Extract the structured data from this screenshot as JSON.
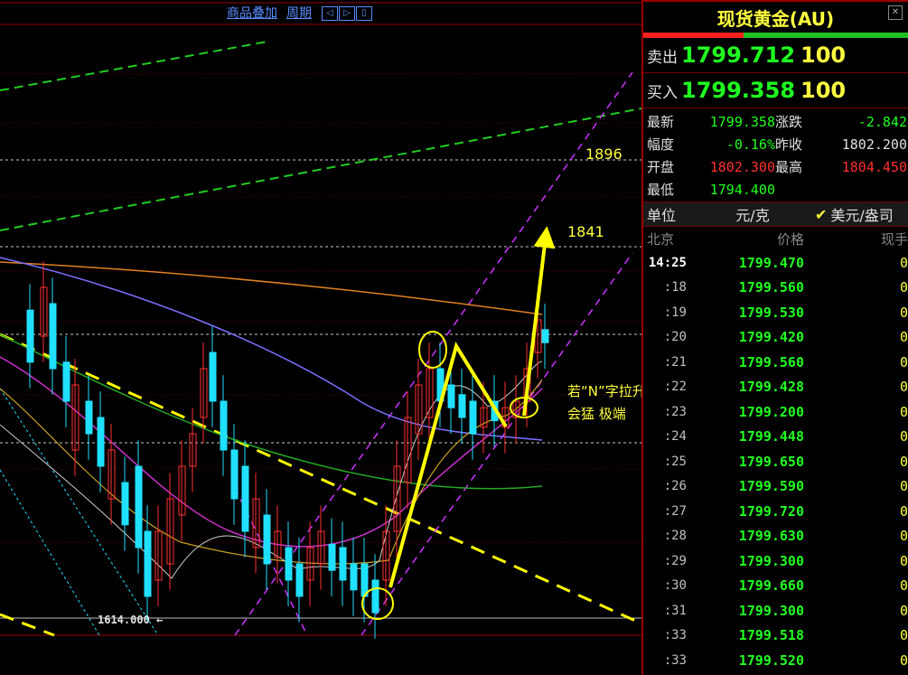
{
  "toolbar": {
    "overlay_label": "商品叠加",
    "period_label": "周期"
  },
  "chart_data": {
    "type": "candlestick",
    "price_labels": [
      {
        "text": "1896",
        "value": 1896
      },
      {
        "text": "1841",
        "value": 1841
      }
    ],
    "low_marker": "1614.000",
    "annotation_line1": "若“N”字拉升",
    "annotation_line2": "会猛 极端",
    "colors": {
      "up": "#ff3030",
      "down": "#20e0ff",
      "target_arrow": "#ffff00",
      "channel": "#cc33ff",
      "trend_green": "#22cc22",
      "resistance": "#ffff00"
    },
    "candles": [
      [
        30,
        28,
        12,
        38,
        -1
      ],
      [
        45,
        20,
        5,
        35,
        1
      ],
      [
        55,
        30,
        10,
        50,
        -1
      ],
      [
        70,
        40,
        28,
        55,
        -1
      ],
      [
        80,
        55,
        35,
        70,
        1
      ],
      [
        95,
        50,
        40,
        65,
        -1
      ],
      [
        108,
        60,
        45,
        80,
        -1
      ],
      [
        120,
        70,
        55,
        85,
        1
      ],
      [
        135,
        78,
        65,
        95,
        -1
      ],
      [
        150,
        85,
        60,
        100,
        -1
      ],
      [
        160,
        100,
        80,
        110,
        -1
      ],
      [
        172,
        95,
        80,
        115,
        1
      ],
      [
        185,
        90,
        70,
        105,
        1
      ],
      [
        198,
        75,
        60,
        95,
        1
      ],
      [
        210,
        60,
        50,
        75,
        1
      ],
      [
        222,
        45,
        30,
        55,
        1
      ],
      [
        232,
        40,
        25,
        50,
        -1
      ],
      [
        244,
        55,
        40,
        65,
        -1
      ],
      [
        256,
        70,
        55,
        80,
        -1
      ],
      [
        268,
        80,
        60,
        90,
        -1
      ],
      [
        280,
        85,
        70,
        95,
        1
      ],
      [
        292,
        90,
        75,
        100,
        -1
      ],
      [
        304,
        88,
        80,
        100,
        1
      ],
      [
        316,
        95,
        85,
        105,
        -1
      ],
      [
        328,
        100,
        90,
        110,
        -1
      ],
      [
        340,
        95,
        85,
        105,
        1
      ],
      [
        352,
        90,
        80,
        100,
        1
      ],
      [
        364,
        92,
        84,
        100,
        -1
      ],
      [
        376,
        95,
        85,
        104,
        -1
      ],
      [
        388,
        98,
        90,
        108,
        -1
      ],
      [
        400,
        100,
        90,
        110,
        -1
      ],
      [
        412,
        105,
        95,
        115,
        -1
      ],
      [
        424,
        95,
        80,
        105,
        1
      ],
      [
        436,
        80,
        60,
        90,
        1
      ],
      [
        448,
        65,
        45,
        80,
        1
      ],
      [
        460,
        50,
        35,
        60,
        1
      ],
      [
        472,
        45,
        30,
        55,
        1
      ],
      [
        484,
        40,
        30,
        48,
        -1
      ],
      [
        496,
        42,
        35,
        50,
        -1
      ],
      [
        508,
        45,
        38,
        52,
        -1
      ],
      [
        520,
        50,
        40,
        58,
        -1
      ],
      [
        532,
        48,
        42,
        55,
        1
      ],
      [
        544,
        46,
        40,
        52,
        -1
      ],
      [
        556,
        48,
        42,
        54,
        1
      ],
      [
        568,
        45,
        40,
        50,
        1
      ],
      [
        580,
        40,
        30,
        48,
        1
      ],
      [
        592,
        25,
        15,
        35,
        1
      ],
      [
        600,
        22,
        18,
        26,
        -1
      ]
    ],
    "note": "Gold spot (AU) candlestick chart with N-pattern projection"
  },
  "panel": {
    "title": "现货黄金(AU)",
    "sell_label": "卖出",
    "sell_price": "1799.712",
    "sell_vol": "100",
    "buy_label": "买入",
    "buy_price": "1799.358",
    "buy_vol": "100",
    "stats": [
      {
        "k": "最新",
        "v": "1799.358",
        "c": "#20ff20"
      },
      {
        "k": "涨跌",
        "v": "-2.842",
        "c": "#20ff20"
      },
      {
        "k": "幅度",
        "v": "-0.16%",
        "c": "#20ff20"
      },
      {
        "k": "昨收",
        "v": "1802.200",
        "c": "#e0e0e0"
      },
      {
        "k": "开盘",
        "v": "1802.300",
        "c": "#ff3030"
      },
      {
        "k": "最高",
        "v": "1804.450",
        "c": "#ff3030"
      },
      {
        "k": "最低",
        "v": "1794.400",
        "c": "#20ff20"
      }
    ],
    "unit_label": "单位",
    "unit_value": "元/克",
    "unit_alt": "美元/盎司",
    "tick_header": {
      "city": "北京",
      "price": "价格",
      "qty": "现手"
    },
    "ticks": [
      {
        "t": "14:25",
        "p": "1799.470",
        "q": "0"
      },
      {
        "t": ":18",
        "p": "1799.560",
        "q": "0"
      },
      {
        "t": ":19",
        "p": "1799.530",
        "q": "0"
      },
      {
        "t": ":20",
        "p": "1799.420",
        "q": "0"
      },
      {
        "t": ":21",
        "p": "1799.560",
        "q": "0"
      },
      {
        "t": ":22",
        "p": "1799.428",
        "q": "0"
      },
      {
        "t": ":23",
        "p": "1799.200",
        "q": "0"
      },
      {
        "t": ":24",
        "p": "1799.448",
        "q": "0"
      },
      {
        "t": ":25",
        "p": "1799.650",
        "q": "0"
      },
      {
        "t": ":26",
        "p": "1799.590",
        "q": "0"
      },
      {
        "t": ":27",
        "p": "1799.720",
        "q": "0"
      },
      {
        "t": ":28",
        "p": "1799.630",
        "q": "0"
      },
      {
        "t": ":29",
        "p": "1799.300",
        "q": "0"
      },
      {
        "t": ":30",
        "p": "1799.660",
        "q": "0"
      },
      {
        "t": ":31",
        "p": "1799.300",
        "q": "0"
      },
      {
        "t": ":33",
        "p": "1799.518",
        "q": "0"
      },
      {
        "t": ":33",
        "p": "1799.520",
        "q": "0"
      }
    ]
  }
}
